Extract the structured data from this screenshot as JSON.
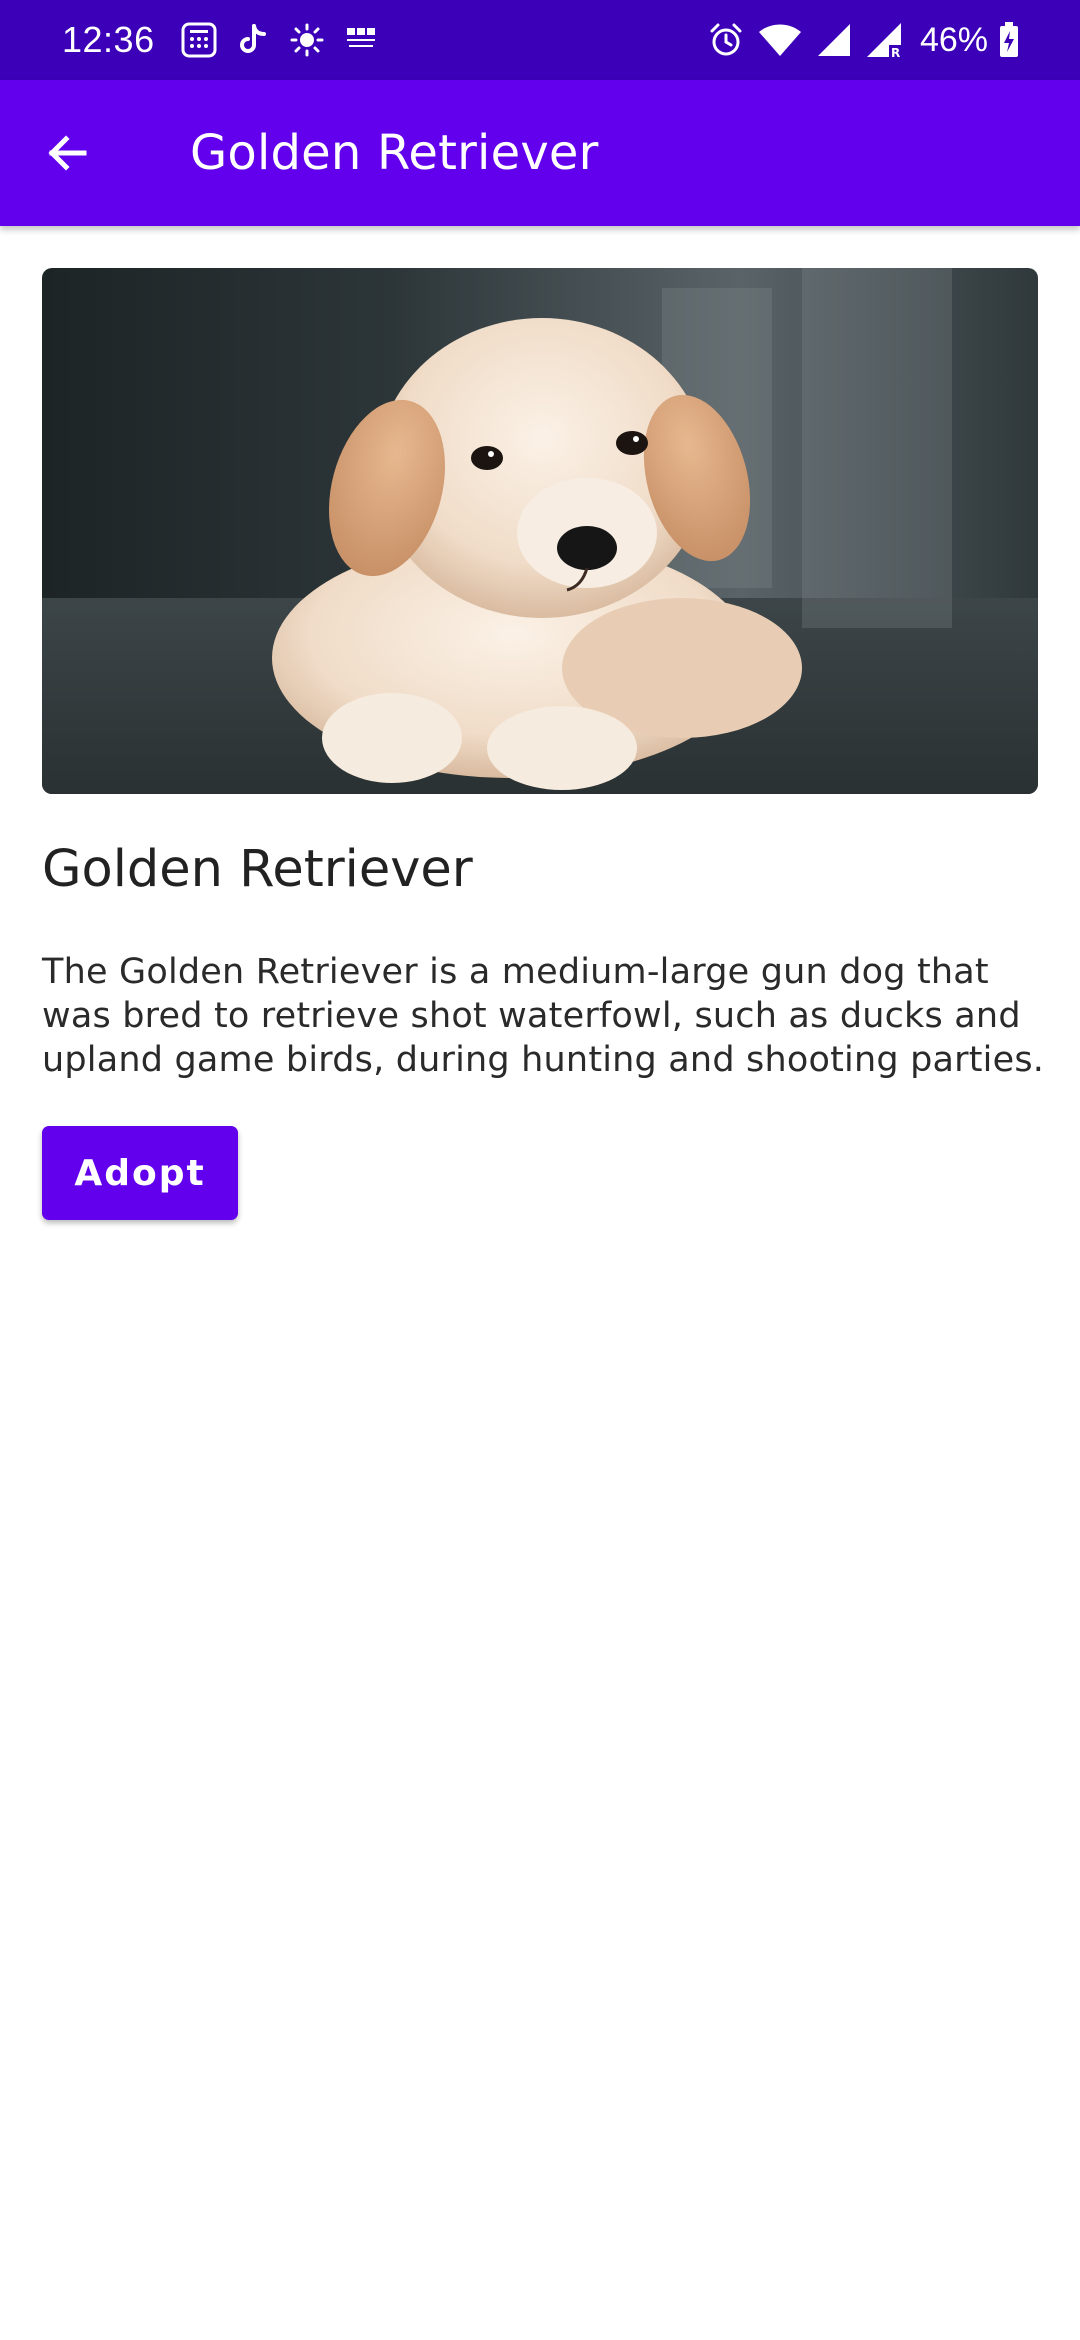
{
  "status_bar": {
    "time": "12:36",
    "battery_percent": "46%",
    "left_icons": [
      "calculator-icon",
      "tiktok-icon",
      "brightness-icon",
      "bbc-learning-english-icon"
    ],
    "right_icons": [
      "alarm-icon",
      "wifi-icon",
      "cell-signal-icon",
      "cell-signal-roaming-icon",
      "battery-charging-icon"
    ],
    "bbc_icon_text": "BBC LEARNING ENGLISH"
  },
  "app_bar": {
    "title": "Golden Retriever",
    "back_icon": "arrow-back-icon"
  },
  "detail": {
    "image_subject": "golden-retriever-puppy",
    "title": "Golden Retriever",
    "description": "The Golden Retriever is a medium-large gun dog that was bred to retrieve shot waterfowl, such as ducks and upland game birds, during hunting and shooting parties.",
    "adopt_label": "Adopt"
  },
  "colors": {
    "status_bar": "#3b00b8",
    "primary": "#6200ee",
    "title_text": "#222222",
    "body_text": "#2a2a2a",
    "background": "#ffffff"
  }
}
